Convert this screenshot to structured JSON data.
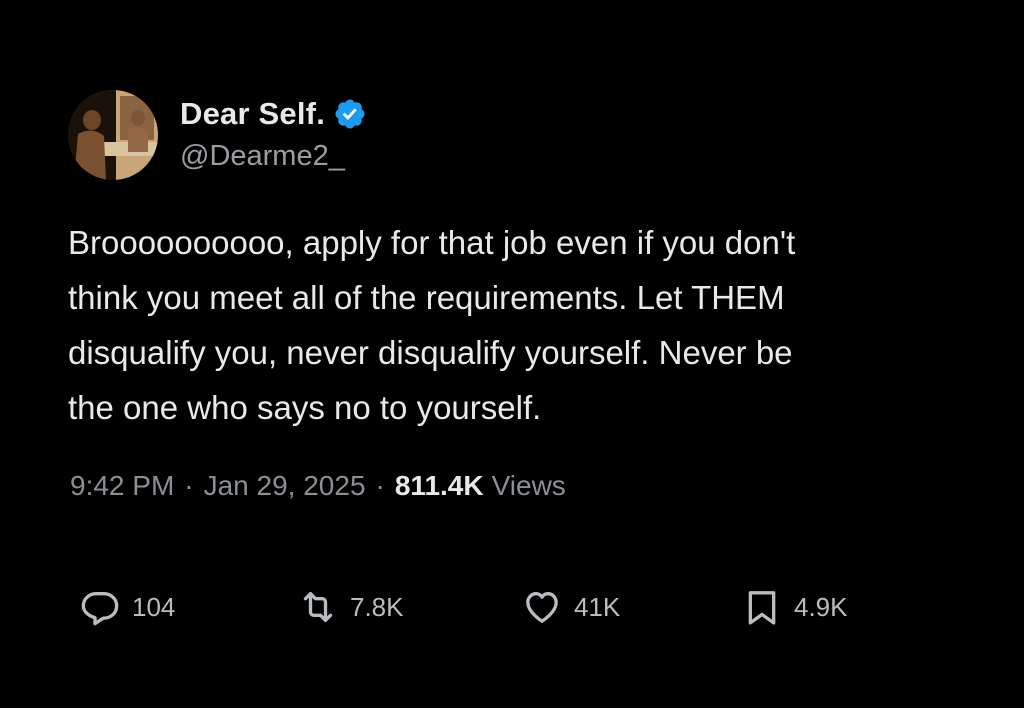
{
  "author": {
    "display_name": "Dear Self.",
    "handle": "@Dearme2_",
    "verified_icon": "verified-badge-icon",
    "verified_color": "#1d9bf0"
  },
  "tweet": {
    "text": "Broooooooooo, apply for that job even if you don't\nthink you meet all of the requirements. Let THEM\ndisqualify you, never disqualify yourself. Never be\nthe one who says no to yourself.",
    "time": "9:42 PM",
    "separator": "·",
    "date": "Jan 29, 2025",
    "views_count": "811.4K",
    "views_label": "Views"
  },
  "actions": {
    "reply": {
      "icon": "reply-icon",
      "count": "104"
    },
    "retweet": {
      "icon": "retweet-icon",
      "count": "7.8K"
    },
    "like": {
      "icon": "heart-icon",
      "count": "41K"
    },
    "bookmark": {
      "icon": "bookmark-icon",
      "count": "4.9K"
    }
  },
  "colors": {
    "background": "#000000",
    "text_primary": "#e7e9ea",
    "text_secondary": "#8b8f94"
  }
}
